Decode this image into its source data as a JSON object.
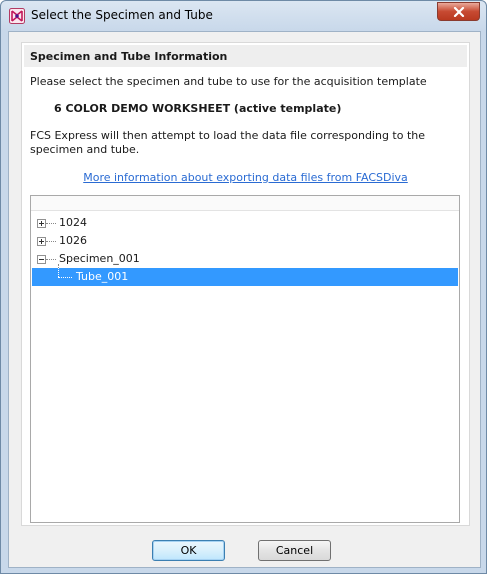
{
  "window": {
    "title": "Select the Specimen and Tube",
    "close_glyph": "✕"
  },
  "panel": {
    "header": "Specimen and Tube Information",
    "instruction": "Please select the specimen and tube to use for the acquisition template",
    "template_name": "6 COLOR DEMO WORKSHEET (active template)",
    "fcs_note": "FCS Express will then attempt to load the data file corresponding to the specimen and tube.",
    "more_info_link": "More information about exporting data files from FACSDiva"
  },
  "tree": {
    "nodes": [
      {
        "label": "1024",
        "level": 0,
        "expander": "plus",
        "selected": false
      },
      {
        "label": "1026",
        "level": 0,
        "expander": "plus",
        "selected": false
      },
      {
        "label": "Specimen_001",
        "level": 0,
        "expander": "minus",
        "selected": false
      },
      {
        "label": "Tube_001",
        "level": 1,
        "expander": "none",
        "selected": true
      }
    ]
  },
  "buttons": {
    "ok": "OK",
    "cancel": "Cancel"
  },
  "colors": {
    "selection": "#3399ff",
    "link": "#2a6bd3",
    "close_button": "#c74a32"
  },
  "icons": {
    "app": "fcs-express-logo-icon",
    "close": "close-icon",
    "expand": "plus-box-icon",
    "collapse": "minus-box-icon"
  }
}
